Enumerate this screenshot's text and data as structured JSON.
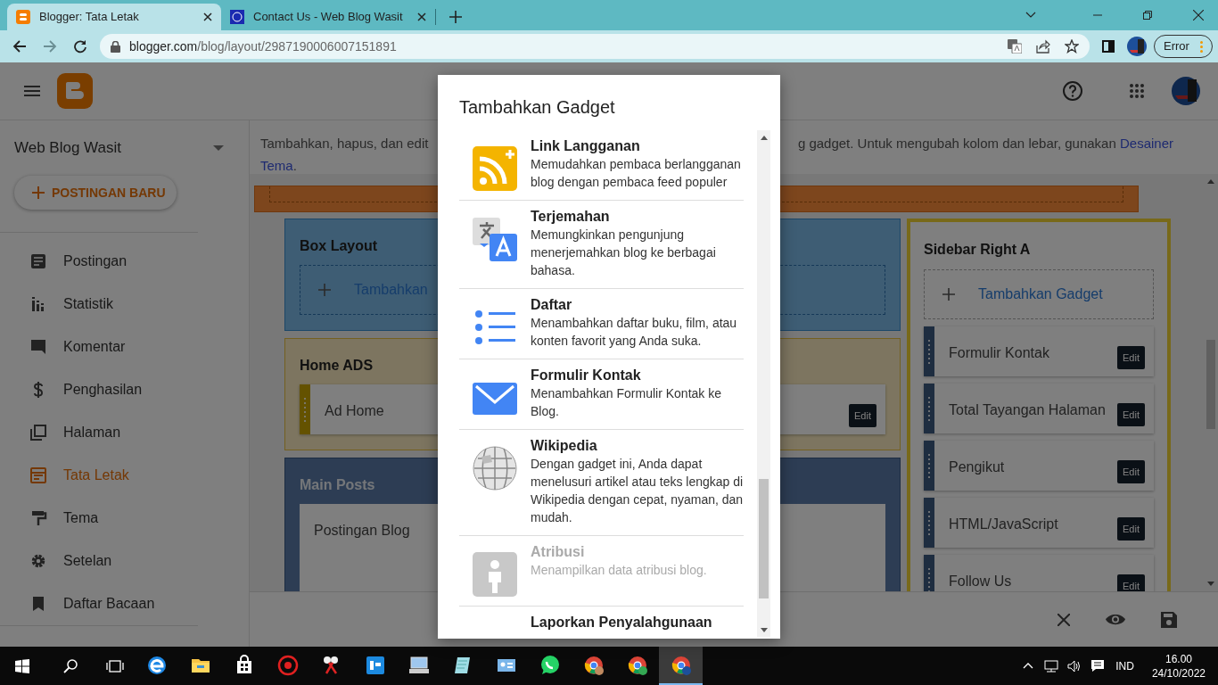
{
  "browser": {
    "tabs": [
      {
        "title": "Blogger: Tata Letak",
        "selected": true
      },
      {
        "title": "Contact Us - Web Blog Wasit",
        "selected": false
      }
    ],
    "url": "blogger.com/blog/layout/2987190006007151891",
    "profile_button": "Error"
  },
  "sidebar": {
    "blog_name": "Web Blog Wasit",
    "new_post_button": "POSTINGAN BARU",
    "items": [
      {
        "label": "Postingan",
        "selected": false
      },
      {
        "label": "Statistik",
        "selected": false
      },
      {
        "label": "Komentar",
        "selected": false
      },
      {
        "label": "Penghasilan",
        "selected": false
      },
      {
        "label": "Halaman",
        "selected": false
      },
      {
        "label": "Tata Letak",
        "selected": true
      },
      {
        "label": "Tema",
        "selected": false
      },
      {
        "label": "Setelan",
        "selected": false
      },
      {
        "label": "Daftar Bacaan",
        "selected": false
      }
    ]
  },
  "description": {
    "left_text": "Tambahkan, hapus, dan edit",
    "left_link": "Tema",
    "left_end": ".",
    "right_text": "g gadget. Untuk mengubah kolom dan lebar, gunakan",
    "right_link": "Desainer"
  },
  "layout": {
    "sections": [
      {
        "title": "Box Layout",
        "add_gadget": "Tambahkan"
      },
      {
        "title": "Home ADS",
        "gadgets": [
          {
            "name": "Ad Home",
            "edit": "Edit"
          }
        ]
      },
      {
        "title": "Main Posts",
        "gadgets": [
          {
            "name": "Postingan Blog"
          }
        ]
      }
    ],
    "sidebar_section": {
      "title": "Sidebar Right A",
      "add_gadget": "Tambahkan Gadget",
      "gadgets": [
        {
          "name": "Formulir Kontak",
          "edit": "Edit"
        },
        {
          "name": "Total Tayangan Halaman",
          "edit": "Edit"
        },
        {
          "name": "Pengikut",
          "edit": "Edit"
        },
        {
          "name": "HTML/JavaScript",
          "edit": "Edit"
        },
        {
          "name": "Follow Us",
          "edit": "Edit"
        }
      ]
    }
  },
  "dialog": {
    "title": "Tambahkan Gadget",
    "items": [
      {
        "title": "Link Langganan",
        "description": "Memudahkan pembaca berlangganan blog dengan pembaca feed populer",
        "disabled": false
      },
      {
        "title": "Terjemahan",
        "description": "Memungkinkan pengunjung menerjemahkan blog ke berbagai bahasa.",
        "disabled": false
      },
      {
        "title": "Daftar",
        "description": "Menambahkan daftar buku, film, atau konten favorit yang Anda suka.",
        "disabled": false
      },
      {
        "title": "Formulir Kontak",
        "description": "Menambahkan Formulir Kontak ke Blog.",
        "disabled": false
      },
      {
        "title": "Wikipedia",
        "description": "Dengan gadget ini, Anda dapat menelusuri artikel atau teks lengkap di Wikipedia dengan cepat, nyaman, dan mudah.",
        "disabled": false
      },
      {
        "title": "Atribusi",
        "description": "Menampilkan data atribusi blog.",
        "disabled": true
      },
      {
        "title": "Laporkan Penyalahgunaan",
        "disabled": false
      }
    ]
  },
  "taskbar": {
    "apps": [
      {
        "selected": false
      },
      {
        "selected": false
      },
      {
        "selected": false
      },
      {
        "selected": false
      },
      {
        "selected": false
      },
      {
        "selected": false
      },
      {
        "selected": false
      },
      {
        "selected": false
      },
      {
        "selected": false
      },
      {
        "selected": false
      },
      {
        "selected": false
      },
      {
        "selected": false
      },
      {
        "selected": true
      }
    ],
    "language": "IND",
    "time": "16.00",
    "date": "24/10/2022"
  }
}
